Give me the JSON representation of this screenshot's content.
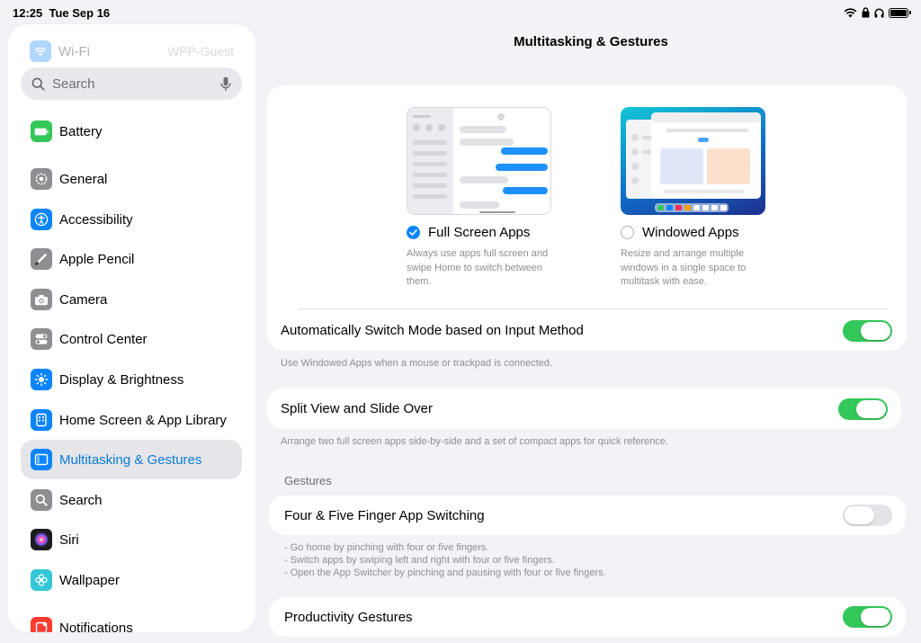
{
  "status_bar": {
    "time": "12:25",
    "date": "Tue Sep 16"
  },
  "sidebar": {
    "ghost_wifi": {
      "label": "Wi-Fi",
      "value": "WPP-Guest",
      "icon": "wifi-icon"
    },
    "search": {
      "placeholder": "Search",
      "icon": "search-icon",
      "mic_icon": "mic-icon"
    },
    "items": [
      {
        "id": "battery",
        "label": "Battery",
        "icon": "battery-icon",
        "color": "#34c759"
      },
      {
        "id": "general",
        "label": "General",
        "icon": "gear-icon",
        "color": "#8e8e93"
      },
      {
        "id": "accessibility",
        "label": "Accessibility",
        "icon": "accessibility-icon",
        "color": "#0a84ff"
      },
      {
        "id": "apple-pencil",
        "label": "Apple Pencil",
        "icon": "pencil-icon",
        "color": "#8e8e93"
      },
      {
        "id": "camera",
        "label": "Camera",
        "icon": "camera-icon",
        "color": "#8e8e93"
      },
      {
        "id": "control-center",
        "label": "Control Center",
        "icon": "switches-icon",
        "color": "#8e8e93"
      },
      {
        "id": "display-brightness",
        "label": "Display & Brightness",
        "icon": "sun-icon",
        "color": "#0a84ff"
      },
      {
        "id": "home-screen",
        "label": "Home Screen & App Library",
        "icon": "home-screen-icon",
        "color": "#0a84ff"
      },
      {
        "id": "multitasking",
        "label": "Multitasking & Gestures",
        "icon": "multitasking-icon",
        "color": "#0a84ff",
        "active": true
      },
      {
        "id": "search",
        "label": "Search",
        "icon": "search-icon",
        "color": "#8e8e93"
      },
      {
        "id": "siri",
        "label": "Siri",
        "icon": "siri-icon",
        "color": "#1c1c1e"
      },
      {
        "id": "wallpaper",
        "label": "Wallpaper",
        "icon": "flower-icon",
        "color": "#34c7d6"
      },
      {
        "id": "notifications",
        "label": "Notifications",
        "icon": "bell-icon",
        "color": "#ff3b30"
      }
    ]
  },
  "main": {
    "title": "Multitasking & Gestures",
    "modes": {
      "full_screen": {
        "label": "Full Screen Apps",
        "description": "Always use apps full screen and swipe Home to switch between them.",
        "selected": true
      },
      "windowed": {
        "label": "Windowed Apps",
        "description": "Resize and arrange multiple windows in a single space to multitask with ease.",
        "selected": false
      }
    },
    "auto_switch": {
      "label": "Automatically Switch Mode based on Input Method",
      "on": true,
      "footnote": "Use Windowed Apps when a mouse or trackpad is connected."
    },
    "split_view": {
      "label": "Split View and Slide Over",
      "on": true,
      "footnote": "Arrange two full screen apps side-by-side and a set of compact apps for quick reference."
    },
    "gestures_header": "Gestures",
    "four_five_finger": {
      "label": "Four & Five Finger App Switching",
      "on": false,
      "footnote_lines": [
        "- Go home by pinching with four or five fingers.",
        "- Switch apps by swiping left and right with four or five fingers.",
        "- Open the App Switcher by pinching and pausing with four or five fingers."
      ]
    },
    "productivity": {
      "label": "Productivity Gestures",
      "on": true
    }
  },
  "colors": {
    "accent": "#0a84ff",
    "toggle_on": "#34c759",
    "active_text": "#0a7cd5"
  }
}
